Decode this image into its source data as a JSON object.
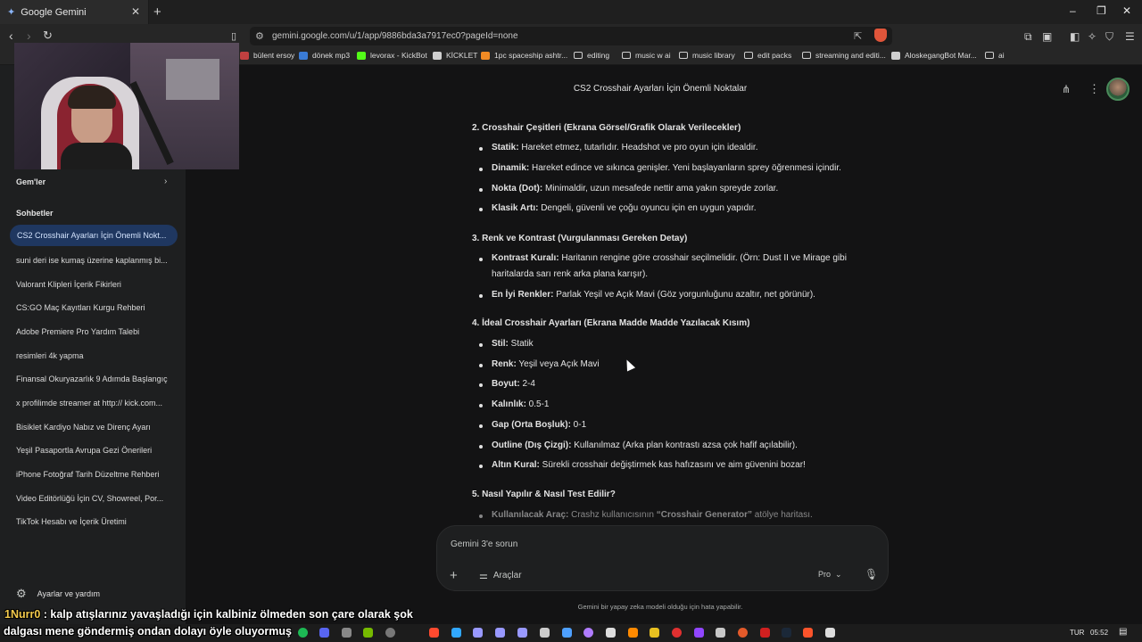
{
  "browser": {
    "tab_title": "Google Gemini",
    "tab_icon": "gemini-icon",
    "url": "gemini.google.com/u/1/app/9886bda3a7917ec0?pageId=none",
    "bookmarks": [
      {
        "label": "bülent ersoy",
        "icon": "music-icon",
        "color": "#c04040"
      },
      {
        "label": "dönek mp3",
        "icon": "link-icon",
        "color": "#3a7bd5"
      },
      {
        "label": "levorax - KickBot",
        "icon": "bot-icon",
        "color": "#53fc18"
      },
      {
        "label": "KİCKLET",
        "icon": "bot-icon",
        "color": "#cfcfcf"
      },
      {
        "label": "1pc spaceship ashtr...",
        "icon": "shop-icon",
        "color": "#f08a24"
      },
      {
        "label": "editing",
        "icon": "folder-icon",
        "color": ""
      },
      {
        "label": "music w ai",
        "icon": "folder-icon",
        "color": ""
      },
      {
        "label": "music library",
        "icon": "folder-icon",
        "color": ""
      },
      {
        "label": "edit packs",
        "icon": "folder-icon",
        "color": ""
      },
      {
        "label": "streaming and editi...",
        "icon": "folder-icon",
        "color": ""
      },
      {
        "label": "AloskegangBot Mar...",
        "icon": "bot-icon",
        "color": "#cfcfcf"
      },
      {
        "label": "ai",
        "icon": "folder-icon",
        "color": ""
      }
    ]
  },
  "sidebar": {
    "gems_label": "Gem'ler",
    "chats_label": "Sohbetler",
    "chats": [
      "CS2 Crosshair Ayarları İçin Önemli Nokt...",
      "suni deri ise kumaş üzerine kaplanmış bi...",
      "Valorant Klipleri İçerik Fikirleri",
      "CS:GO Maç Kayıtları Kurgu Rehberi",
      "Adobe Premiere Pro Yardım Talebi",
      "resimleri 4k yapma",
      "Finansal Okuryazarlık 9 Adımda Başlangıç",
      "x profilimde streamer at http:// kick.com...",
      "Bisiklet Kardiyo Nabız ve Direnç Ayarı",
      "Yeşil Pasaportla Avrupa Gezi Önerileri",
      "iPhone Fotoğraf Tarih Düzeltme Rehberi",
      "Video Editörlüğü İçin CV, Showreel, Por...",
      "TikTok Hesabı ve İçerik Üretimi"
    ],
    "settings_label": "Ayarlar ve yardım"
  },
  "conversation": {
    "title": "CS2 Crosshair Ayarları İçin Önemli Noktalar",
    "section2": {
      "heading": "2. Crosshair Çeşitleri (Ekrana Görsel/Grafik Olarak Verilecekler)",
      "items": [
        {
          "term": "Statik:",
          "text": " Hareket etmez, tutarlıdır. Headshot ve pro oyun için idealdir."
        },
        {
          "term": "Dinamik:",
          "text": " Hareket edince ve sıkınca genişler. Yeni başlayanların sprey öğrenmesi içindir."
        },
        {
          "term": "Nokta (Dot):",
          "text": " Minimaldir, uzun mesafede nettir ama yakın spreyde zorlar."
        },
        {
          "term": "Klasik Artı:",
          "text": " Dengeli, güvenli ve çoğu oyuncu için en uygun yapıdır."
        }
      ]
    },
    "section3": {
      "heading": "3. Renk ve Kontrast (Vurgulanması Gereken Detay)",
      "items": [
        {
          "term": "Kontrast Kuralı:",
          "text": " Haritanın rengine göre crosshair seçilmelidir. (Örn: Dust II ve Mirage gibi",
          "text2": "haritalarda sarı renk arka plana karışır)."
        },
        {
          "term": "En İyi Renkler:",
          "text": " Parlak Yeşil ve Açık Mavi (Göz yorgunluğunu azaltır, net görünür)."
        }
      ]
    },
    "section4": {
      "heading": "4. İdeal Crosshair Ayarları (Ekrana Madde Madde Yazılacak Kısım)",
      "items": [
        {
          "term": "Stil:",
          "text": " Statik"
        },
        {
          "term": "Renk:",
          "text": " Yeşil veya Açık Mavi"
        },
        {
          "term": "Boyut:",
          "text": " 2-4"
        },
        {
          "term": "Kalınlık:",
          "text": " 0.5-1"
        },
        {
          "term": "Gap (Orta Boşluk):",
          "text": " 0-1"
        },
        {
          "term": "Outline (Dış Çizgi):",
          "text": " Kullanılmaz (Arka plan kontrastı azsa çok hafif açılabilir)."
        },
        {
          "term": "Altın Kural:",
          "text": " Sürekli crosshair değiştirmek kas hafızasını ve aim güvenini bozar!"
        }
      ]
    },
    "section5": {
      "heading": "5. Nasıl Yapılır & Nasıl Test Edilir?",
      "item_term": "Kullanılacak Araç:",
      "item_text": " Crashz kullanıcısının ",
      "item_quote": "“Crosshair Generator”",
      "item_tail": " atölye haritası."
    }
  },
  "input": {
    "placeholder": "Gemini 3'e sorun",
    "tools_label": "Araçlar",
    "model_label": "Pro"
  },
  "disclaimer": "Gemini bir yapay zeka modeli olduğu için hata yapabilir.",
  "stream_overlay": {
    "username": "1Nurr0",
    "line1": " : kalp atışlarınız yavaşladığı için kalbiniz ölmeden son çare olarak şok",
    "line2": "dalgası mene göndermiş ondan dolayı öyle oluyormuş"
  },
  "taskbar": {
    "language": "TUR",
    "time": "05:52"
  }
}
